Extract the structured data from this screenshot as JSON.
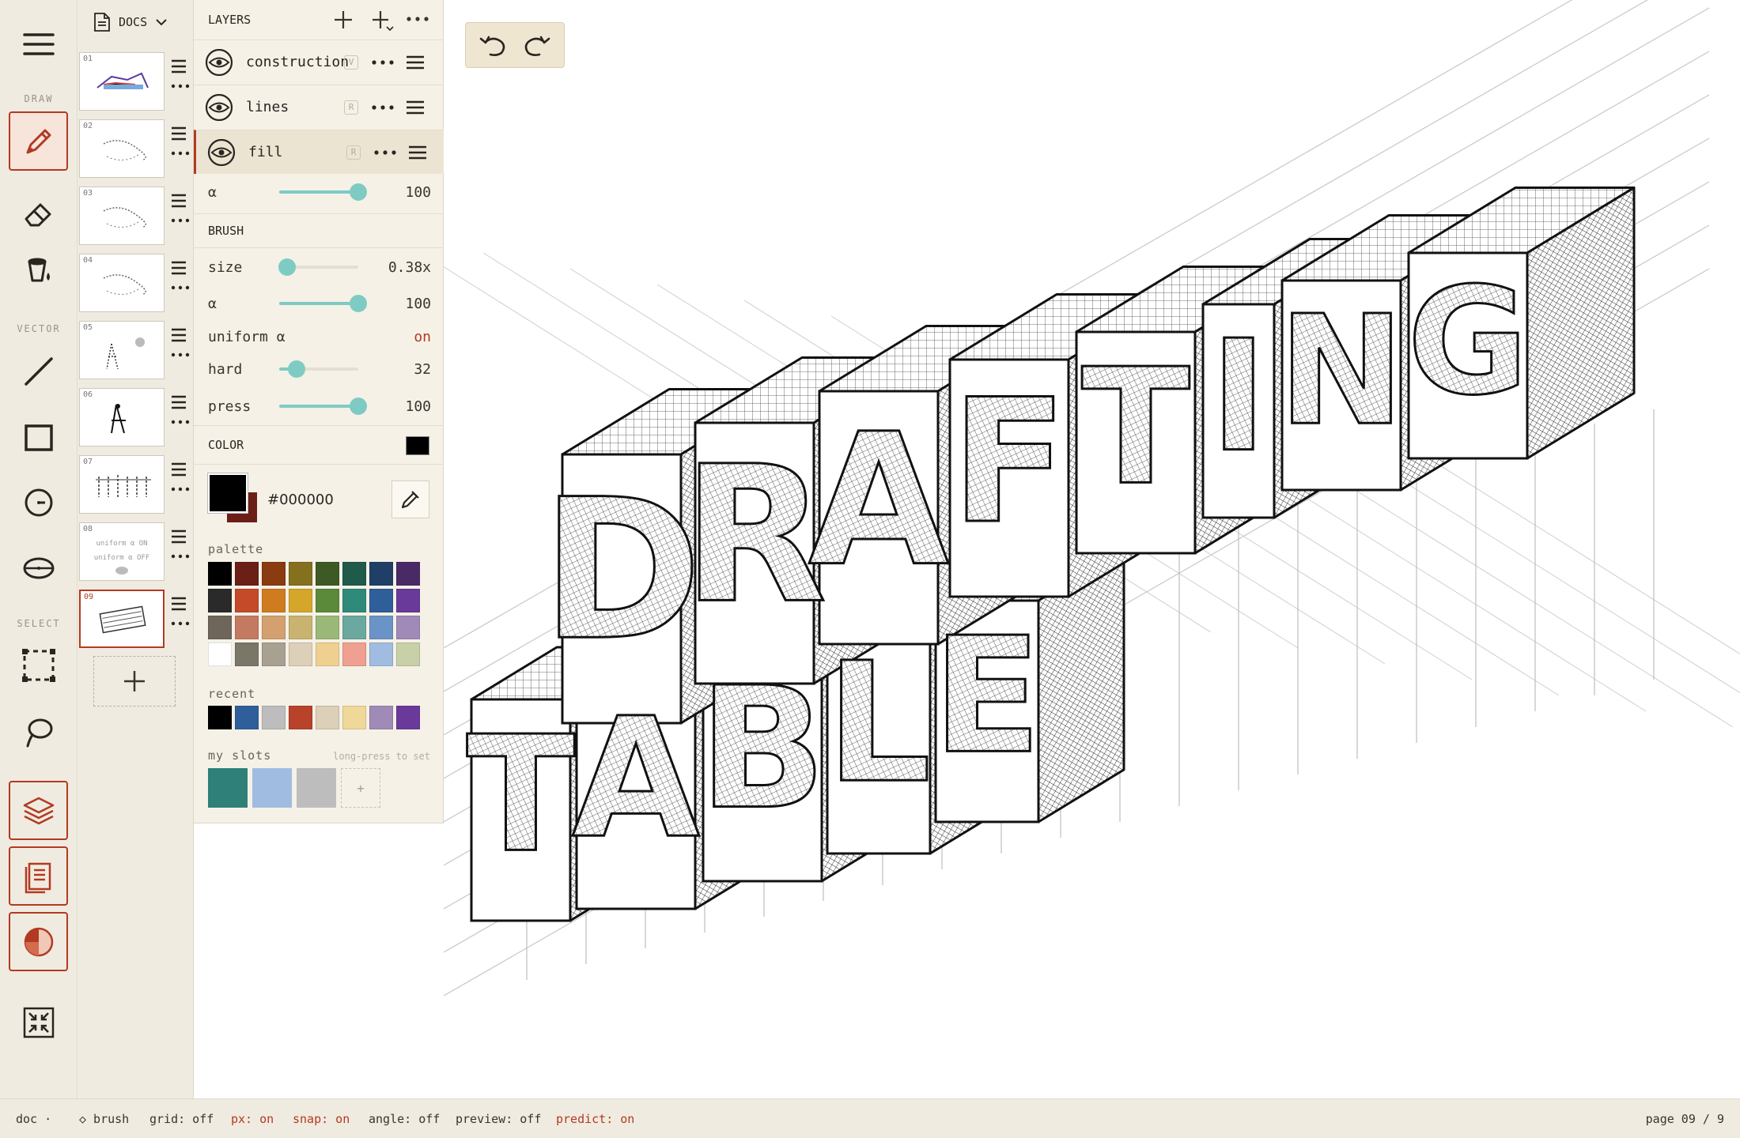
{
  "toolbar": {
    "sections": {
      "draw": "DRAW",
      "vector": "VECTOR",
      "select": "SELECT"
    },
    "tools": [
      "menu",
      "pen",
      "eraser",
      "fill-bucket",
      "line",
      "rectangle",
      "ellipse",
      "ellipse-flat",
      "marquee",
      "lasso",
      "layers",
      "pages",
      "color",
      "fit-screen"
    ],
    "active_tool": "pen"
  },
  "pages": {
    "header": "DOCS",
    "items": [
      {
        "num": "01"
      },
      {
        "num": "02"
      },
      {
        "num": "03"
      },
      {
        "num": "04"
      },
      {
        "num": "05"
      },
      {
        "num": "06"
      },
      {
        "num": "07"
      },
      {
        "num": "08"
      },
      {
        "num": "09",
        "active": true
      }
    ],
    "page8_text": [
      "uniform α ON",
      "uniform α OFF"
    ]
  },
  "layers": {
    "title": "LAYERS",
    "items": [
      {
        "name": "construction",
        "badge": "V"
      },
      {
        "name": "lines",
        "badge": "R"
      },
      {
        "name": "fill",
        "badge": "R",
        "active": true
      }
    ],
    "alpha_label": "α",
    "alpha_value": "100",
    "alpha_fraction": 1.0
  },
  "brush": {
    "title": "BRUSH",
    "size_label": "size",
    "size_value": "0.38x",
    "size_fraction": 0.1,
    "alpha_label": "α",
    "alpha_value": "100",
    "alpha_fraction": 1.0,
    "uniform_label": "uniform α",
    "uniform_value": "on",
    "hard_label": "hard",
    "hard_value": "32",
    "hard_fraction": 0.22,
    "press_label": "press",
    "press_value": "100",
    "press_fraction": 1.0
  },
  "color": {
    "title": "COLOR",
    "primary": "#000000",
    "secondary": "#6b1f16",
    "hex": "#000000",
    "palette_label": "palette",
    "palette": [
      "#000000",
      "#6b1f16",
      "#8a3b10",
      "#85701e",
      "#3d5a25",
      "#1f5a4a",
      "#1f3f66",
      "#4a2a66",
      "#2a2a2a",
      "#c44a2a",
      "#cf7c20",
      "#d4a62a",
      "#5a8a3a",
      "#2f8a7a",
      "#2f5f9a",
      "#6a3a9a",
      "#6e665a",
      "#c47a60",
      "#d4a070",
      "#c8b470",
      "#9ab878",
      "#6aa8a0",
      "#6a94c8",
      "#a08ab8",
      "#ffffff",
      "#7a7668",
      "#a8a090",
      "#dcd0b8",
      "#f0d090",
      "#f0a090",
      "#a0bce0",
      "#c8d0a8"
    ],
    "recent_label": "recent",
    "recent": [
      "#000000",
      "#2f5f9a",
      "#bdbdbd",
      "#b8432a",
      "#dcd0b8",
      "#f0d898",
      "#a08ab8",
      "#6a3a9a"
    ],
    "slots_label": "my slots",
    "slots_hint": "long-press to set",
    "slots": [
      "#2f8078",
      "#a0bce0",
      "#bdbdbd"
    ]
  },
  "status": {
    "doc": "doc ·",
    "tool": "◇ brush",
    "grid": "grid: off",
    "px": "px: on",
    "snap": "snap: on",
    "angle": "angle: off",
    "preview": "preview: off",
    "predict": "predict: on",
    "page": "page 09 / 9"
  },
  "canvas": {
    "letters_row1": [
      "D",
      "R",
      "A",
      "F",
      "T",
      "I",
      "N",
      "G"
    ],
    "letters_row2": [
      "T",
      "A",
      "B",
      "L",
      "E"
    ]
  }
}
